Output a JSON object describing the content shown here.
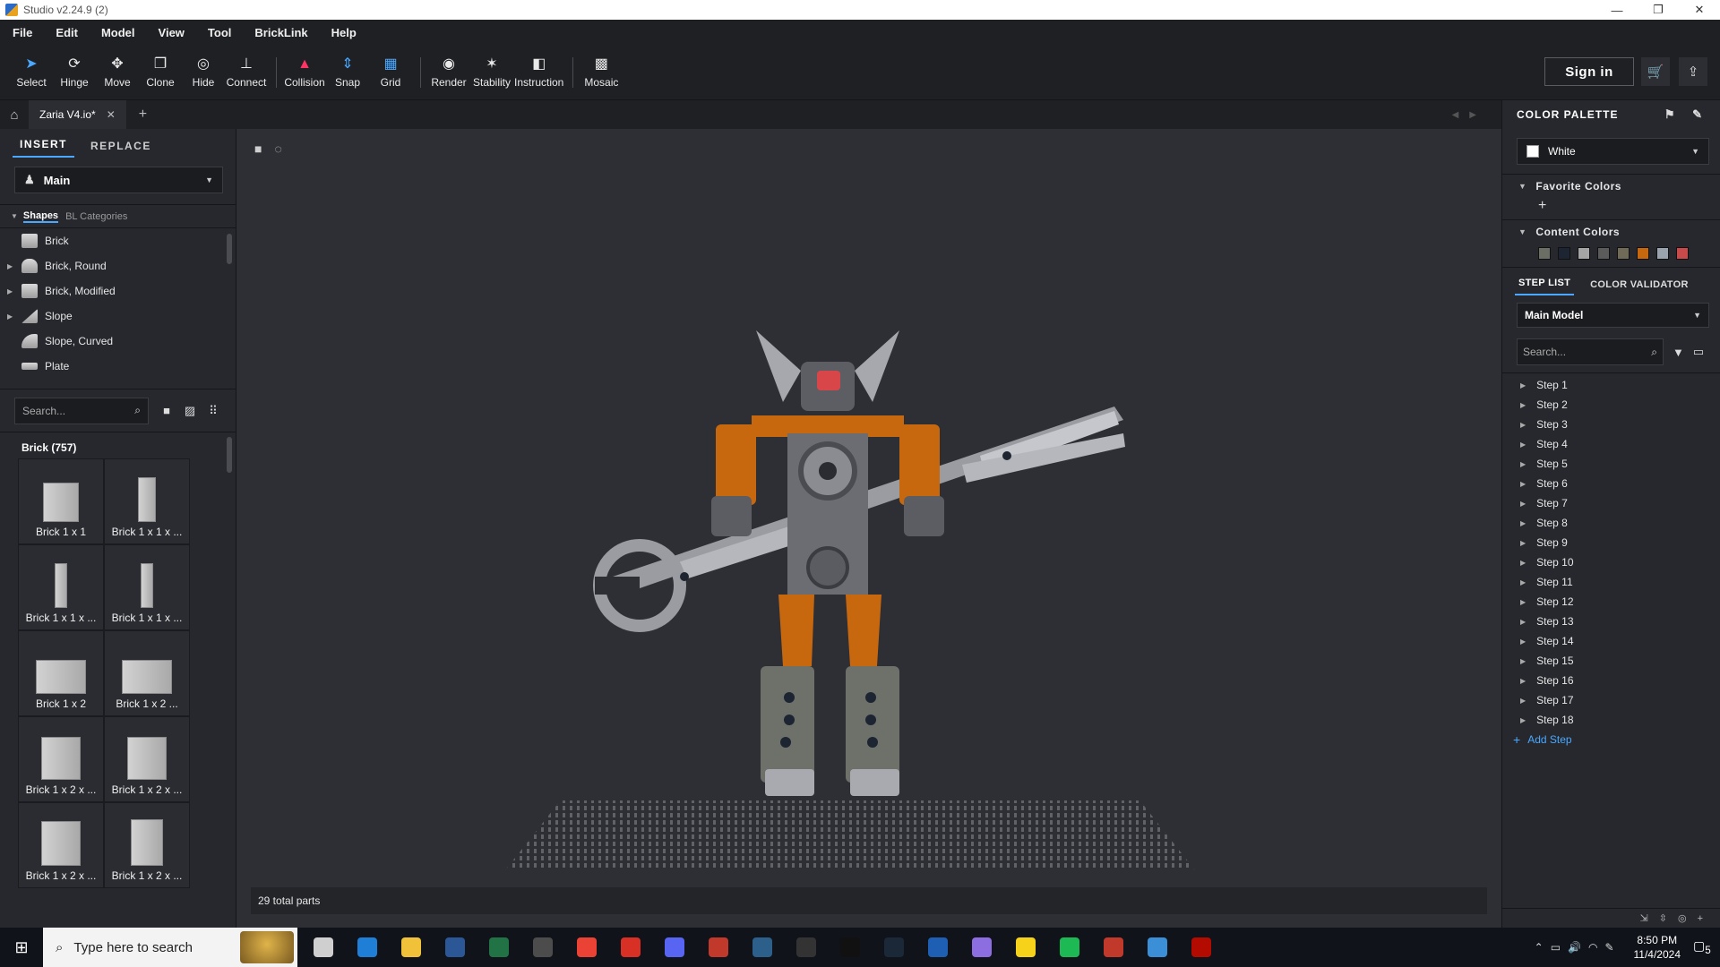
{
  "window": {
    "title": "Studio v2.24.9 (2)",
    "controls": [
      "—",
      "❐",
      "✕"
    ]
  },
  "menu": [
    "File",
    "Edit",
    "Model",
    "View",
    "Tool",
    "BrickLink",
    "Help"
  ],
  "toolbar": {
    "tools": [
      {
        "label": "Select",
        "icon": "➤"
      },
      {
        "label": "Hinge",
        "icon": "⟳"
      },
      {
        "label": "Move",
        "icon": "✥"
      },
      {
        "label": "Clone",
        "icon": "❐"
      },
      {
        "label": "Hide",
        "icon": "◎"
      },
      {
        "label": "Connect",
        "icon": "⊥"
      },
      {
        "label": "Collision",
        "icon": "▲"
      },
      {
        "label": "Snap",
        "icon": "⇕"
      },
      {
        "label": "Grid",
        "icon": "▦"
      },
      {
        "label": "Render",
        "icon": "◉"
      },
      {
        "label": "Stability",
        "icon": "✶"
      },
      {
        "label": "Instruction",
        "icon": "◧"
      },
      {
        "label": "Mosaic",
        "icon": "▩"
      }
    ],
    "sign_in": "Sign in",
    "cart_icon": "🛒",
    "upload_icon": "⇪"
  },
  "tabs": {
    "home_icon": "⌂",
    "document": "Zaria V4.io*",
    "close": "✕",
    "add": "+",
    "nav": "◀▶"
  },
  "left_panel": {
    "insert_tab": "INSERT",
    "replace_tab": "REPLACE",
    "palette": "Main",
    "shapes_tab": "Shapes",
    "bl_tab": "BL Categories",
    "categories": [
      {
        "label": "Brick",
        "expandable": false
      },
      {
        "label": "Brick, Round",
        "expandable": true
      },
      {
        "label": "Brick, Modified",
        "expandable": true
      },
      {
        "label": "Slope",
        "expandable": true
      },
      {
        "label": "Slope, Curved",
        "expandable": false
      },
      {
        "label": "Plate",
        "expandable": false
      }
    ],
    "search_placeholder": "Search...",
    "grid_header": "Brick (757)",
    "bricks": [
      {
        "label": "Brick 1 x 1",
        "w": 40,
        "h": 44
      },
      {
        "label": "Brick 1 x 1 x ...",
        "w": 20,
        "h": 50
      },
      {
        "label": "Brick 1 x 1 x ...",
        "w": 14,
        "h": 50
      },
      {
        "label": "Brick 1 x 1 x ...",
        "w": 14,
        "h": 50
      },
      {
        "label": "Brick 1 x 2",
        "w": 56,
        "h": 38
      },
      {
        "label": "Brick 1 x 2 ...",
        "w": 56,
        "h": 38
      },
      {
        "label": "Brick 1 x 2 x ...",
        "w": 44,
        "h": 48
      },
      {
        "label": "Brick 1 x 2 x ...",
        "w": 44,
        "h": 48
      },
      {
        "label": "Brick 1 x 2 x ...",
        "w": 44,
        "h": 50
      },
      {
        "label": "Brick 1 x 2 x ...",
        "w": 36,
        "h": 52
      }
    ]
  },
  "viewport": {
    "camera_icon": "■",
    "rotate_icon": "◌",
    "status": "29 total parts"
  },
  "right_panel": {
    "header": "COLOR PALETTE",
    "header_icons": "⚑ ✎",
    "selected_color": "White",
    "favorite_colors": "Favorite Colors",
    "fav_add": "+",
    "content_colors": "Content Colors",
    "swatches": [
      "#6b6e64",
      "#1d2533",
      "#a5a5a5",
      "#5b5b5b",
      "#6f6b58",
      "#c8680e",
      "#9aa4ae",
      "#c94a4a"
    ],
    "step_list_tab": "STEP LIST",
    "color_validator_tab": "COLOR VALIDATOR",
    "model": "Main Model",
    "step_search_placeholder": "Search...",
    "steps": [
      "Step 1",
      "Step 2",
      "Step 3",
      "Step 4",
      "Step 5",
      "Step 6",
      "Step 7",
      "Step 8",
      "Step 9",
      "Step 10",
      "Step 11",
      "Step 12",
      "Step 13",
      "Step 14",
      "Step 15",
      "Step 16",
      "Step 17",
      "Step 18"
    ],
    "add_step": "Add Step"
  },
  "taskbar": {
    "search_placeholder": "Type here to search",
    "apps": [
      "#cfcfcf",
      "#1f7fd6",
      "#f2c13a",
      "#2b5797",
      "#217346",
      "#4c4c4c",
      "#ea4335",
      "#d93025",
      "#5865f2",
      "#c0392b",
      "#2d5f8b",
      "#333333",
      "#111111",
      "#1b2838",
      "#1e5fb3",
      "#8c6ee0",
      "#f7d21a",
      "#1db954",
      "#c0392b",
      "#3a8fd6",
      "#b30b00"
    ],
    "time": "8:50 PM",
    "date": "11/4/2024",
    "notifications": "5"
  }
}
